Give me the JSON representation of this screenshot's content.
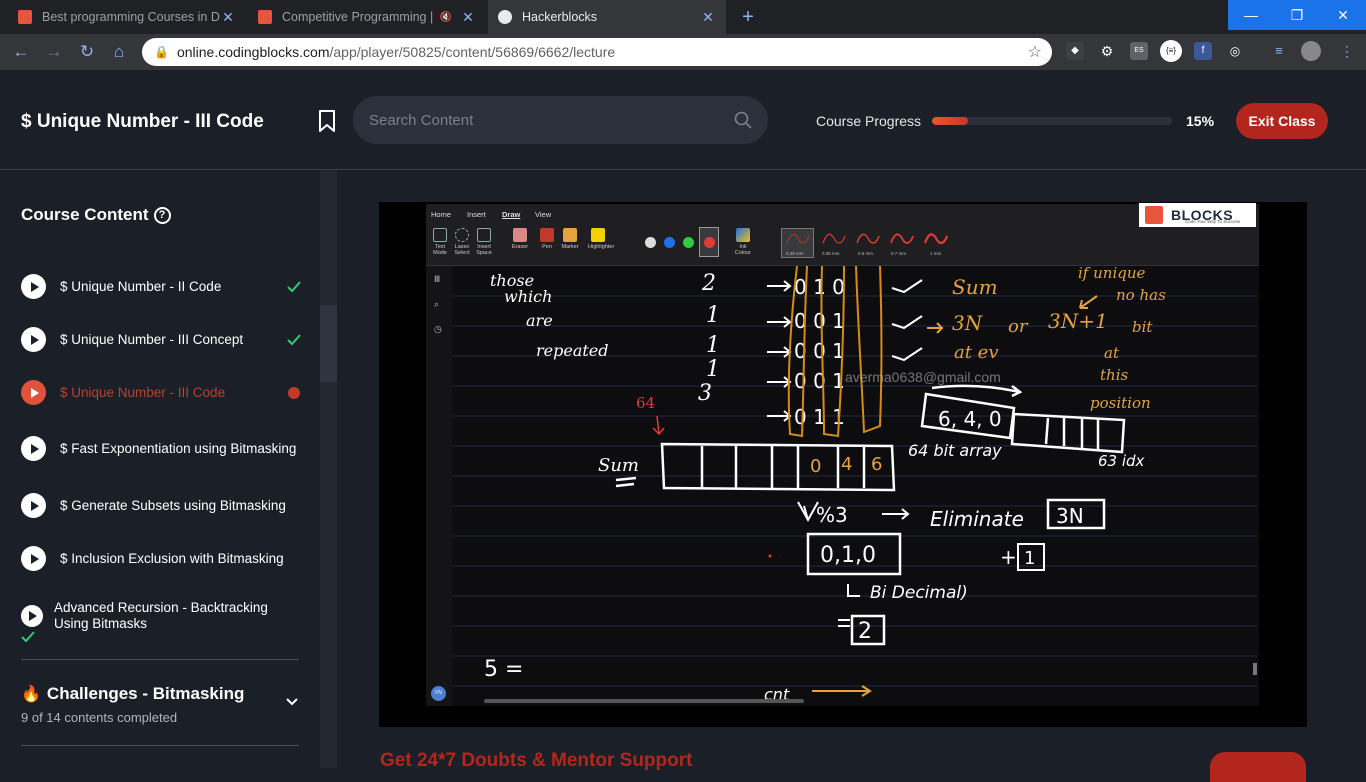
{
  "browser": {
    "tabs": [
      {
        "title": "Best programming Courses in De",
        "favicon_color": "#e8553d",
        "active": false
      },
      {
        "title": "Competitive Programming | ",
        "favicon_color": "#e8553d",
        "active": false
      },
      {
        "title": "Hackerblocks",
        "favicon_color": "#e8eaed",
        "active": true
      }
    ],
    "url_host": "online.codingblocks.com",
    "url_path": "/app/player/50825/content/56869/6662/lecture",
    "new_tab": "+",
    "win_min": "—",
    "win_max": "❐",
    "win_close": "✕",
    "extension_es": "ES",
    "extension_json": "{≡}",
    "extension_fb": "f"
  },
  "header": {
    "lecture_title": "$ Unique Number - III Code",
    "search_placeholder": "Search Content",
    "progress_label": "Course Progress",
    "progress_value": 0.15,
    "progress_text": "15%",
    "exit_label": "Exit Class",
    "accent": "#b3261e"
  },
  "sidebar": {
    "heading": "Course Content",
    "items": [
      {
        "label": "$ Unique Number - II Code",
        "state": "done"
      },
      {
        "label": "$ Unique Number - III Concept",
        "state": "done"
      },
      {
        "label": "$ Unique Number - III Code",
        "state": "current"
      },
      {
        "label": "$ Fast Exponentiation using Bitmasking",
        "state": "todo"
      },
      {
        "label": "$ Generate Subsets using Bitmasking",
        "state": "todo"
      },
      {
        "label": "$ Inclusion Exclusion with Bitmasking",
        "state": "todo"
      },
      {
        "label": "Advanced Recursion - Backtracking Using Bitmasks",
        "state": "done"
      }
    ],
    "section": {
      "title": "Challenges - Bitmasking",
      "subtitle": "9 of 14 contents completed"
    }
  },
  "video": {
    "ribbon_tabs": [
      "Home",
      "Insert",
      "Draw",
      "View"
    ],
    "active_ribbon_tab": "Draw",
    "tools": [
      "Text Mode",
      "Lasso Select",
      "Insert Space",
      "Eraser",
      "Pen",
      "Marker",
      "Highlighter",
      "Ink Colour"
    ],
    "pen_sizes": [
      "0.25 mm",
      "0.35 mm",
      "0.5 mm",
      "0.7 mm",
      "1 mm"
    ],
    "logo_text": "BLOCKS",
    "logo_tagline": "Code Your Way To Success",
    "watermark": "averma0638@gmail.com",
    "fn_badge": "FN",
    "ink": {
      "notes_left": [
        "those",
        "which",
        "are",
        "repeated"
      ],
      "column_numbers": [
        "2",
        "1",
        "1",
        "1",
        "3"
      ],
      "bit_rows": [
        "0 1 0",
        "0 0 1",
        "0 0 1",
        "0 0 1",
        "0 1 1"
      ],
      "sum_label": "Sum",
      "sum_label_left": "Sum",
      "three_n": "3N",
      "or_label": "or",
      "three_n_plus_one": "3N+1",
      "at_ev": "at ev",
      "if_unique_note": [
        "if unique",
        "no has",
        "bit",
        "at",
        "this",
        "position"
      ],
      "bit_label_64": "64",
      "sum_array": [
        "4",
        "6"
      ],
      "sum_array_zero": "0",
      "array_label": "64 bit array",
      "counts": "6, 4, 0",
      "idx_label": "63 idx",
      "mod_label": "%3",
      "eliminate": "Eliminate",
      "eliminate_box": "3N",
      "result_bits": "0,1,0",
      "plus_one": "1",
      "bin_decimal": "Bi Decimal)",
      "result_value": "2",
      "five": "5 =",
      "cnt": "cnt"
    }
  },
  "bottom": {
    "teaser": "Get 24*7 Doubts & Mentor Support"
  }
}
